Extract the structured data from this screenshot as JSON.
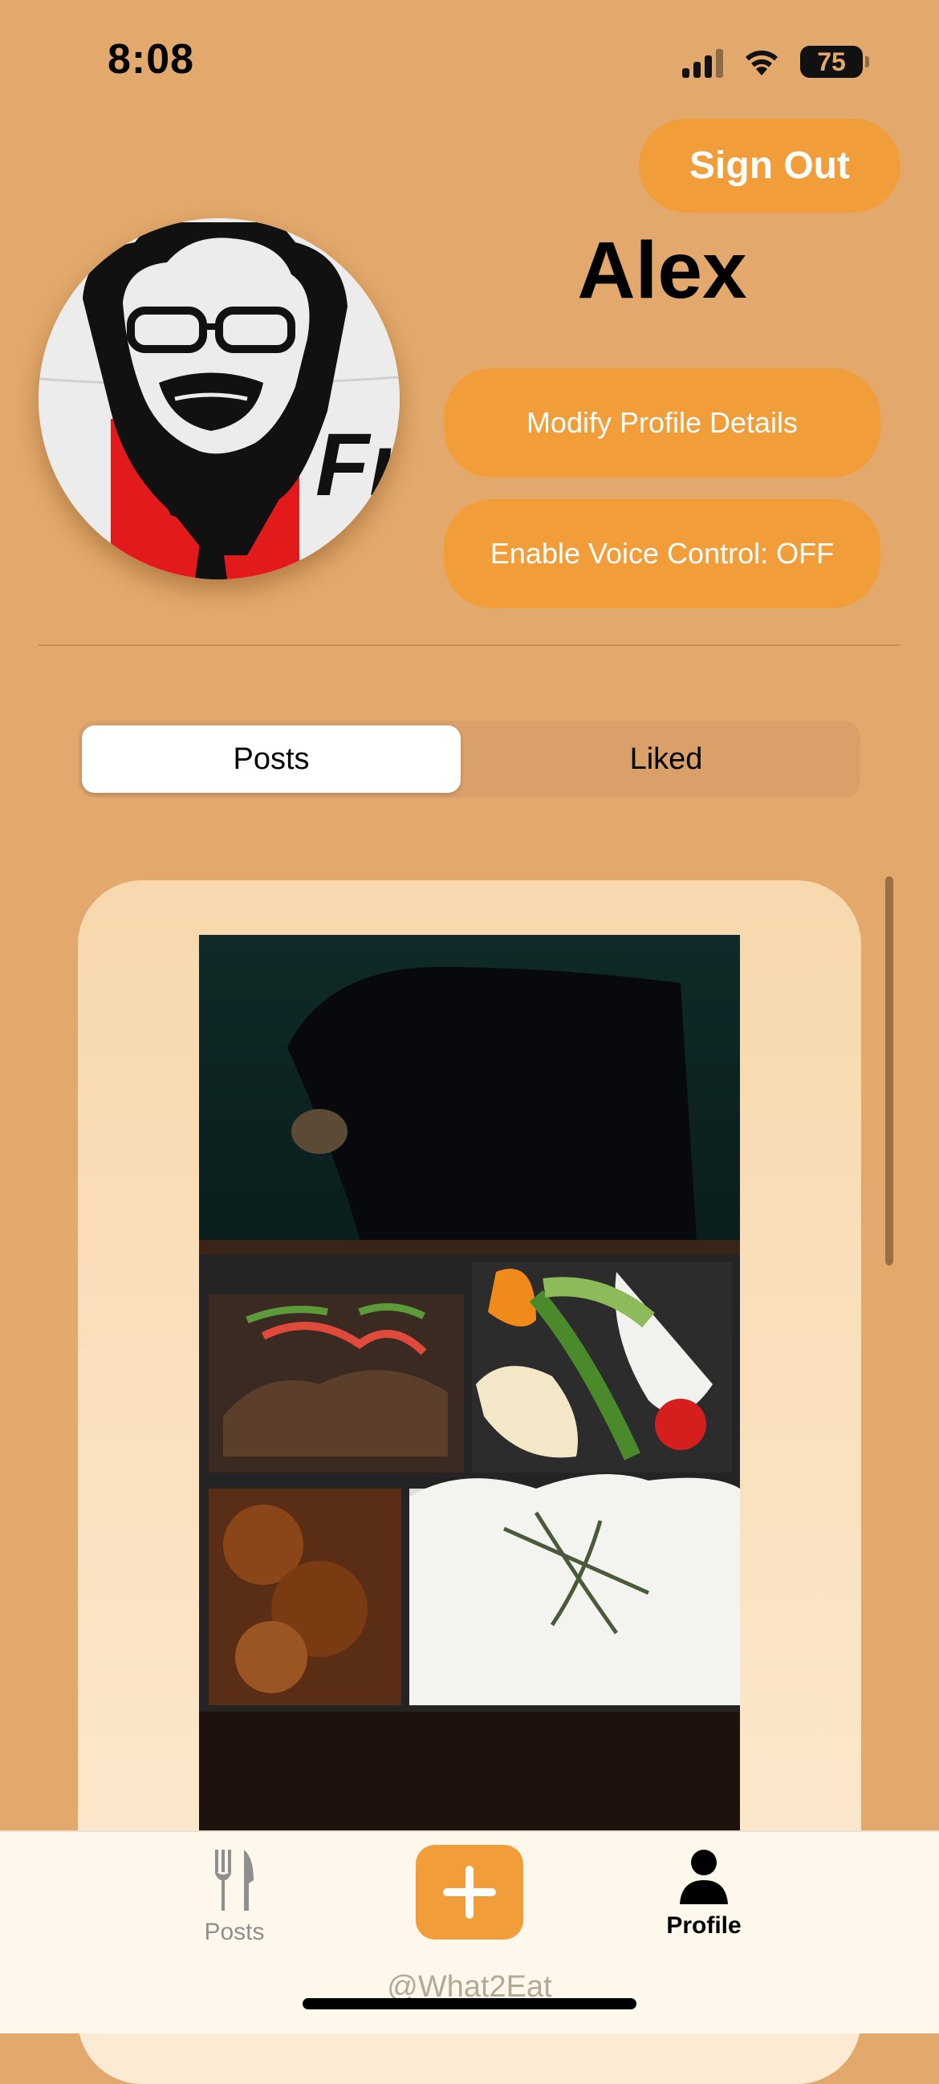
{
  "status_bar": {
    "time": "8:08",
    "battery": "75"
  },
  "header": {
    "sign_out_label": "Sign Out"
  },
  "profile": {
    "name": "Alex",
    "modify_label": "Modify Profile Details",
    "voice_label": "Enable Voice Control: OFF",
    "avatar_text": "Fr"
  },
  "segments": {
    "posts": "Posts",
    "liked": "Liked",
    "selected": "Posts"
  },
  "tabbar": {
    "posts_label": "Posts",
    "profile_label": "Profile",
    "watermark": "@What2Eat"
  },
  "colors": {
    "accent": "#F19D3A",
    "background": "#E3A96C",
    "card": "#F8D8AD"
  }
}
